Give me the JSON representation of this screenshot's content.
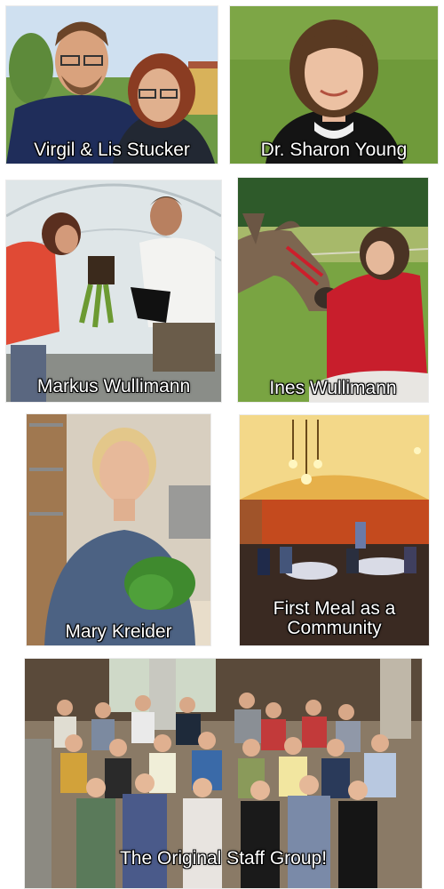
{
  "tiles": [
    {
      "caption": "Virgil & Lis Stucker"
    },
    {
      "caption": "Dr. Sharon Young"
    },
    {
      "caption": "Markus Wullimann"
    },
    {
      "caption": "Ines Wullimann"
    },
    {
      "caption": "Mary Kreider"
    },
    {
      "caption": "First Meal as a Community"
    },
    {
      "caption": "The Original Staff Group!"
    }
  ]
}
